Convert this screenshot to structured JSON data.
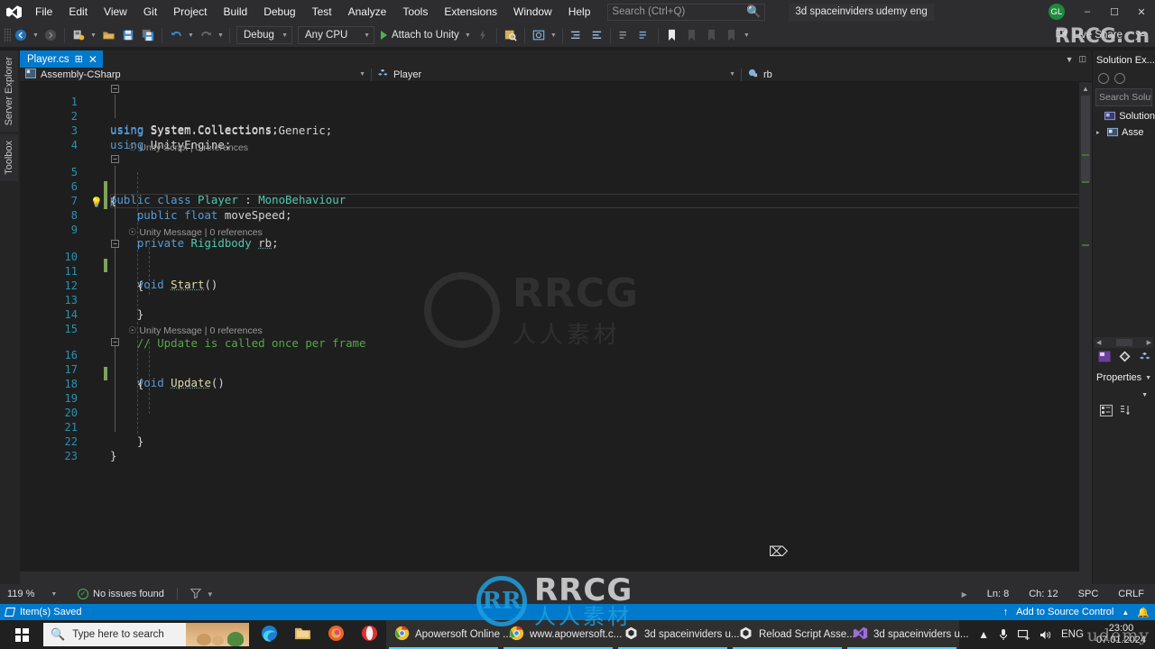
{
  "titlebar": {
    "logo_icon": "visual-studio-logo",
    "menus": [
      "File",
      "Edit",
      "View",
      "Git",
      "Project",
      "Build",
      "Debug",
      "Test",
      "Analyze",
      "Tools",
      "Extensions",
      "Window",
      "Help"
    ],
    "search_placeholder": "Search (Ctrl+Q)",
    "search_icon": "magnifier-icon",
    "solution_name": "3d spaceinviders udemy eng",
    "account_initials": "GL",
    "window_controls": [
      "minimize",
      "restore",
      "close"
    ]
  },
  "toolbar": {
    "nav_back_icon": "navigate-back-icon",
    "nav_fwd_icon": "navigate-forward-icon",
    "new_item_icon": "new-project-icon",
    "open_icon": "open-file-icon",
    "save_icon": "save-icon",
    "save_all_icon": "save-all-icon",
    "undo_icon": "undo-icon",
    "redo_icon": "redo-icon",
    "config_value": "Debug",
    "platform_value": "Any CPU",
    "run_label": "Attach to Unity",
    "run_icon": "play-icon",
    "find_in_files_icon": "find-in-files-icon",
    "screenshot_icon": "screen-capture-icon",
    "indent_icon": "indent-icon",
    "outdent_icon": "outdent-icon",
    "comment_icon": "comment-icon",
    "uncomment_icon": "uncomment-icon",
    "bookmark_icon": "bookmark-icon",
    "bm_prev_icon": "bookmark-prev-icon",
    "bm_next_icon": "bookmark-next-icon",
    "bm_clear_icon": "bookmark-clear-icon",
    "live_share_label": "Live Share",
    "live_share_icon": "live-share-icon",
    "feedback_icon": "feedback-icon"
  },
  "leftrail": {
    "tabs": [
      "Server Explorer",
      "Toolbox"
    ]
  },
  "tabstrip": {
    "active_tab": "Player.cs",
    "pin_icon": "pin-icon",
    "close_icon": "close-icon",
    "overflow_icon": "tab-overflow-icon"
  },
  "navbar": {
    "project": "Assembly-CSharp",
    "project_icon": "csharp-project-icon",
    "type": "Player",
    "type_icon": "class-icon",
    "member": "rb",
    "member_icon": "field-icon"
  },
  "editor": {
    "language": "csharp",
    "current_line": 8,
    "lines": [
      {
        "n": 1,
        "text": "using System.Collections;"
      },
      {
        "n": 2,
        "text": "using System.Collections.Generic;"
      },
      {
        "n": 3,
        "text": "using UnityEngine;"
      },
      {
        "n": 4,
        "text": ""
      },
      {
        "n": 5,
        "text": "public class Player : MonoBehaviour"
      },
      {
        "n": 6,
        "text": "{"
      },
      {
        "n": 7,
        "text": "    public float moveSpeed;"
      },
      {
        "n": 8,
        "text": "    private Rigidbody rb;"
      },
      {
        "n": 9,
        "text": ""
      },
      {
        "n": 10,
        "text": "    void Start()"
      },
      {
        "n": 11,
        "text": "    {"
      },
      {
        "n": 12,
        "text": "        "
      },
      {
        "n": 13,
        "text": "    }"
      },
      {
        "n": 14,
        "text": ""
      },
      {
        "n": 15,
        "text": "    // Update is called once per frame"
      },
      {
        "n": 16,
        "text": "    void Update()"
      },
      {
        "n": 17,
        "text": "    {"
      },
      {
        "n": 18,
        "text": ""
      },
      {
        "n": 19,
        "text": "        "
      },
      {
        "n": 20,
        "text": ""
      },
      {
        "n": 21,
        "text": "    }"
      },
      {
        "n": 22,
        "text": "}"
      },
      {
        "n": 23,
        "text": ""
      }
    ],
    "codelens": [
      {
        "above_line": 5,
        "label": "Unity Script",
        "refs": "0 references"
      },
      {
        "above_line": 10,
        "label": "Unity Message",
        "refs": "0 references"
      },
      {
        "above_line": 16,
        "label": "Unity Message",
        "refs": "0 references"
      }
    ],
    "lightbulb_line": 8,
    "lightbulb_icon": "lightbulb-icon"
  },
  "solution_explorer": {
    "title": "Solution Ex...",
    "search_placeholder": "Search Solu",
    "search_icon": "search-solution-icon",
    "items": [
      {
        "label": "Solution",
        "icon": "solution-icon",
        "expander": ""
      },
      {
        "label": "Asse",
        "icon": "folder-project-icon",
        "expander": "▸"
      }
    ],
    "tabs": [
      {
        "name": "solution-explorer-tab",
        "icon": "solution-explorer-icon"
      },
      {
        "name": "git-changes-tab",
        "icon": "git-changes-icon"
      },
      {
        "name": "class-view-tab",
        "icon": "class-view-icon"
      }
    ]
  },
  "properties_panel": {
    "title": "Properties",
    "dropdown_icon": "chevron-down-icon",
    "categorized_icon": "categorized-view-icon",
    "alphabetical_icon": "alphabetical-view-icon"
  },
  "editor_status": {
    "zoom": "119 %",
    "issues": "No issues found",
    "issues_icon": "check-circle-icon",
    "filter_icon": "filter-icon",
    "line": "Ln: 8",
    "col": "Ch: 12",
    "spaces": "SPC",
    "eol": "CRLF"
  },
  "vs_status_bar": {
    "message": "Item(s) Saved",
    "message_icon": "saved-icon",
    "source_control": "Add to Source Control",
    "source_control_icon": "upload-icon",
    "notifications_icon": "bell-icon"
  },
  "taskbar": {
    "start_icon": "windows-start-icon",
    "search_placeholder": "Type here to search",
    "search_icon": "magnifier-icon",
    "buttons": [
      {
        "label": "",
        "icon": "edge-icon",
        "active": false,
        "wide": false
      },
      {
        "label": "",
        "icon": "file-explorer-icon",
        "active": false,
        "wide": false
      },
      {
        "label": "",
        "icon": "firefox-icon",
        "active": false,
        "wide": false
      },
      {
        "label": "",
        "icon": "opera-icon",
        "active": false,
        "wide": false
      },
      {
        "label": "Apowersoft Online ...",
        "icon": "chrome-icon",
        "active": true,
        "wide": true
      },
      {
        "label": "www.apowersoft.c...",
        "icon": "chrome-icon",
        "active": true,
        "wide": true
      },
      {
        "label": "3d spaceinviders u...",
        "icon": "unity-icon",
        "active": true,
        "wide": true
      },
      {
        "label": "Reload Script Asse...",
        "icon": "unity-icon",
        "active": true,
        "wide": true
      },
      {
        "label": "3d spaceinviders u...",
        "icon": "visual-studio-icon",
        "active": true,
        "wide": true
      }
    ],
    "tray": {
      "chevron_icon": "show-hidden-icons-icon",
      "mic_icon": "microphone-icon",
      "network_icon": "network-icon",
      "volume_icon": "volume-icon",
      "language": "ENG",
      "time": "23:00",
      "date": "07.01.2024"
    }
  },
  "watermarks": {
    "center": "RRCG",
    "center_sub": "人人素材",
    "bottom": "RRCG",
    "bottom_sub": "人人素材",
    "bottom_logo": "RR",
    "top_right": "RRCG.cn",
    "bottom_right": "udemy"
  },
  "colors": {
    "accent": "#007acc",
    "chrome": "#2d2d30",
    "editor_bg": "#1e1e1e",
    "keyword": "#569cd6",
    "type": "#4ec9b0",
    "comment": "#57a64a",
    "linenum": "#2b91af"
  }
}
